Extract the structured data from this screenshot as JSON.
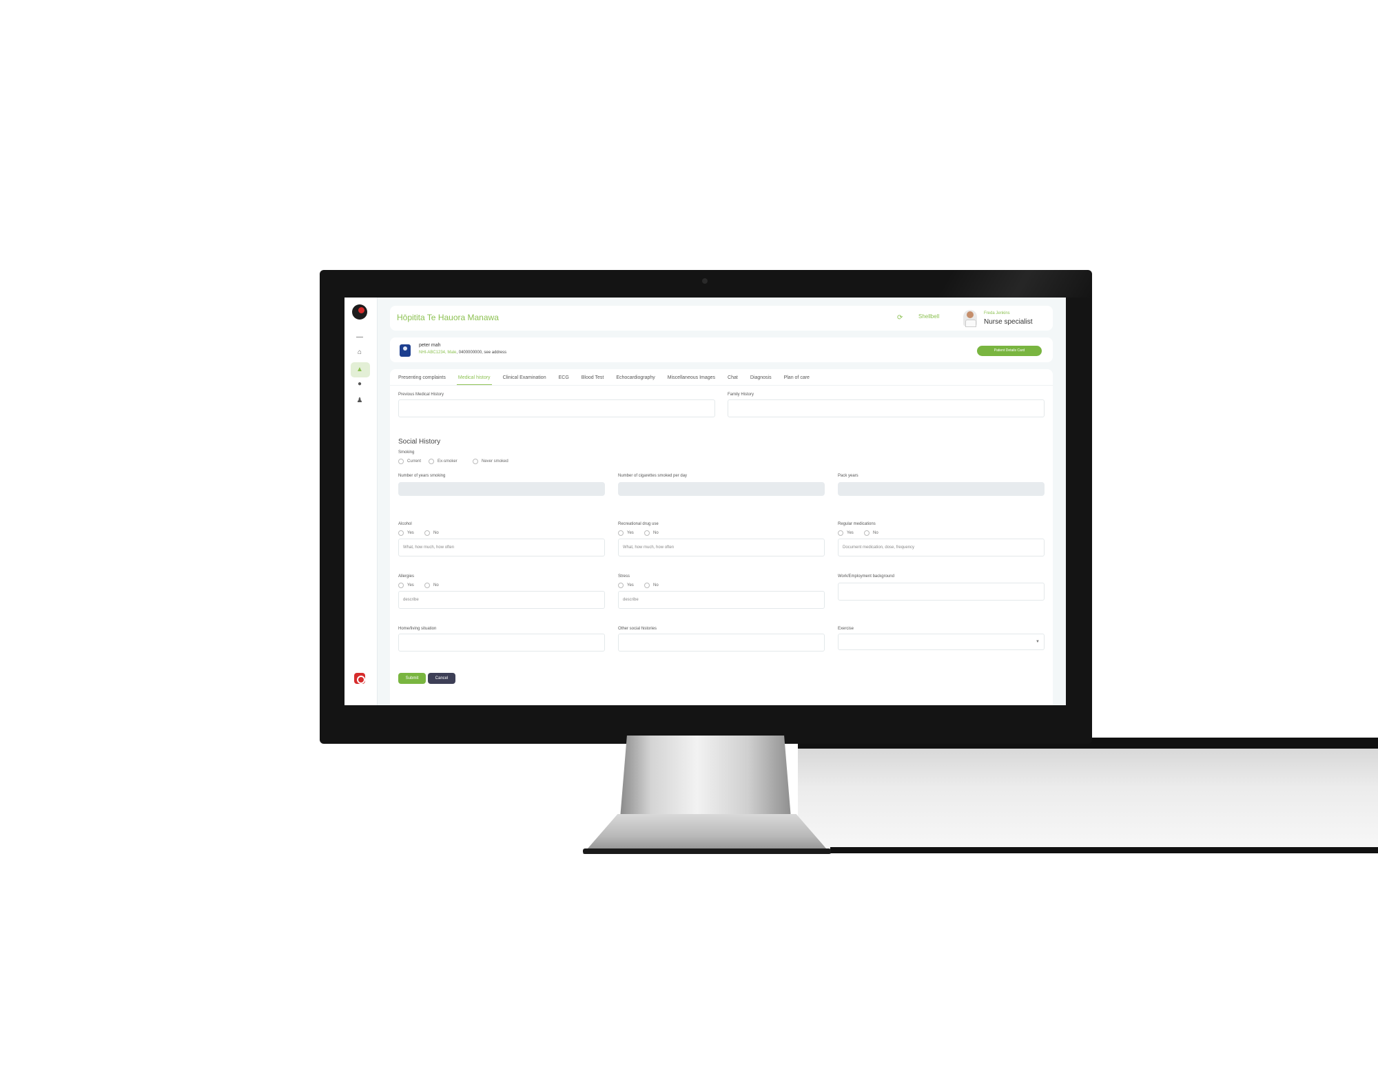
{
  "header": {
    "title": "Hōpitita Te Hauora Manawa",
    "link_label": "Shellbell",
    "user_name": "Freda Jenkins",
    "user_role": "Nurse specialist"
  },
  "patient": {
    "name": "peter mah",
    "nhi": "NHI-ABC1234, Male",
    "meta": ", 0400000000, see address",
    "status_button": "Patient Details Card"
  },
  "tabs": [
    {
      "label": "Presenting complaints"
    },
    {
      "label": "Medical history"
    },
    {
      "label": "Clinical Examination"
    },
    {
      "label": "ECG"
    },
    {
      "label": "Blood Test"
    },
    {
      "label": "Echocardiography"
    },
    {
      "label": "Miscellaneous Images"
    },
    {
      "label": "Chat"
    },
    {
      "label": "Diagnosis"
    },
    {
      "label": "Plan of care"
    }
  ],
  "form": {
    "previous_medical_history_label": "Previous Medical History",
    "family_history_label": "Family History",
    "social_history_title": "Social History",
    "smoking_label": "Smoking",
    "smoking_options": [
      "Current",
      "Ex-smoker",
      "Never smoked"
    ],
    "years_smoking_label": "Number of years smoking",
    "cigarettes_label": "Number of cigarettes smoked per day",
    "pack_years_label": "Pack years",
    "alcohol_label": "Alcohol",
    "drug_use_label": "Recreational drug use",
    "medications_label": "Regular medications",
    "yes_label": "Yes",
    "no_label": "No",
    "what_how_placeholder": "What, how much, how often",
    "medications_placeholder": "Document medication, dose, frequency",
    "allergies_label": "Allergies",
    "stress_label": "Stress",
    "describe_placeholder": "describe",
    "work_label": "Work/Employment background",
    "housing_label": "Home/living situation",
    "other_social_label": "Other social histories",
    "exercise_label": "Exercise",
    "submit_label": "Submit",
    "cancel_label": "Cancel"
  },
  "colors": {
    "accent": "#8cc152",
    "button_green": "#79b540",
    "button_dark": "#3d3f56"
  }
}
